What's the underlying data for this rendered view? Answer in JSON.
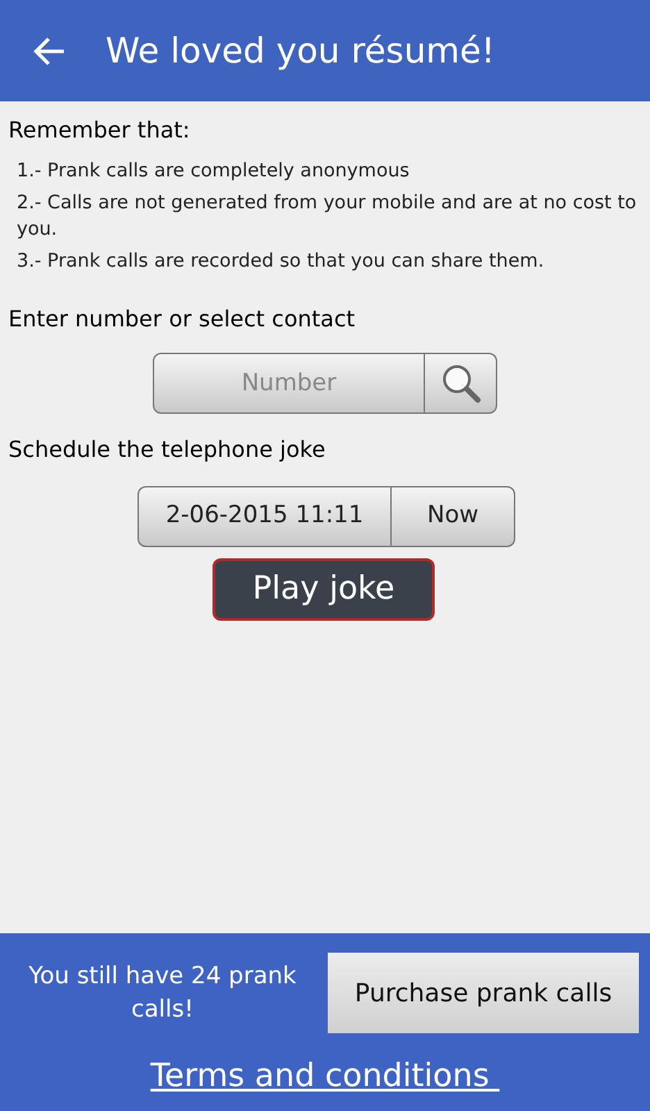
{
  "header": {
    "title": "We loved you résumé!"
  },
  "remember": {
    "heading": "Remember that:",
    "items": [
      "1.- Prank calls are completely anonymous",
      "2.- Calls are not generated from your mobile and are at no cost to you.",
      "3.- Prank calls are recorded so that you can share them."
    ]
  },
  "number": {
    "label": "Enter number or select contact",
    "placeholder": "Number"
  },
  "schedule": {
    "label": "Schedule the telephone joke",
    "datetime": "2-06-2015 11:11",
    "now_button": "Now"
  },
  "play_button": "Play joke",
  "footer": {
    "remaining": "You still have 24 prank calls!",
    "purchase_button": "Purchase prank calls",
    "terms_link": "Terms and conditions "
  }
}
